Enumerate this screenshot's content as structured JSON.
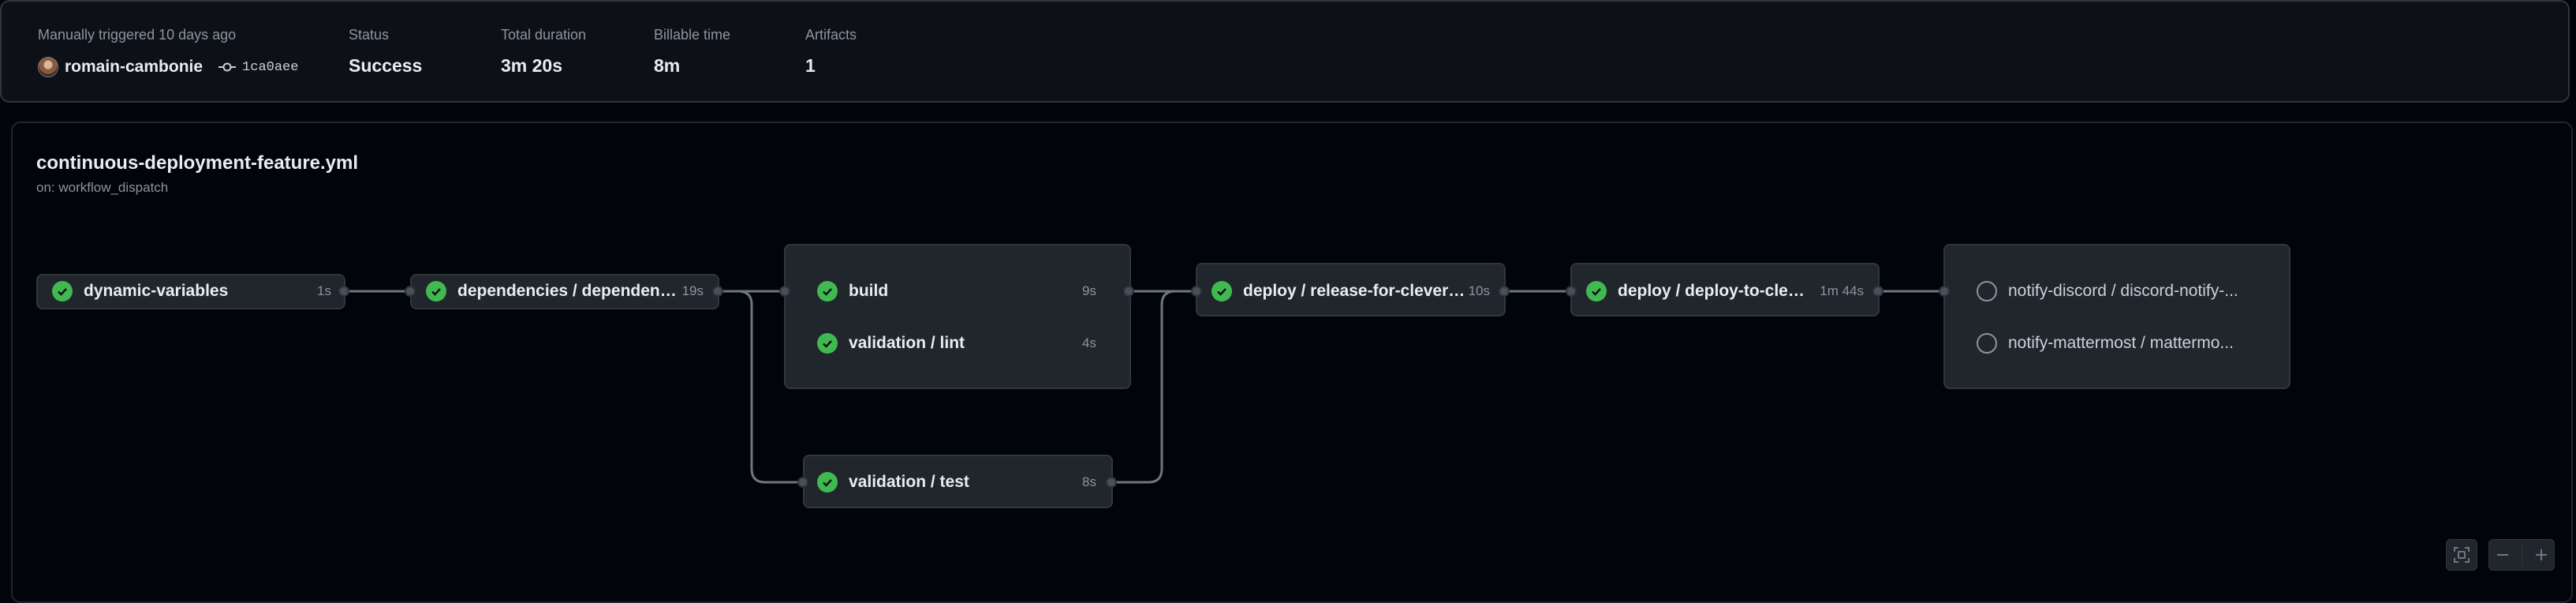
{
  "summary": {
    "trigger_text": "Manually triggered 10 days ago",
    "actor": "romain-cambonie",
    "commit_sha": "1ca0aee",
    "status_label": "Status",
    "status_value": "Success",
    "duration_label": "Total duration",
    "duration_value": "3m 20s",
    "billable_label": "Billable time",
    "billable_value": "8m",
    "artifacts_label": "Artifacts",
    "artifacts_value": "1"
  },
  "workflow": {
    "file": "continuous-deployment-feature.yml",
    "trigger": "on: workflow_dispatch"
  },
  "jobs": [
    {
      "name": "dynamic-variables",
      "duration": "1s",
      "status": "success"
    },
    {
      "name": "dependencies / dependencies",
      "duration": "19s",
      "status": "success"
    },
    {
      "name": "build",
      "duration": "9s",
      "status": "success"
    },
    {
      "name": "validation / lint",
      "duration": "4s",
      "status": "success"
    },
    {
      "name": "validation / test",
      "duration": "8s",
      "status": "success"
    },
    {
      "name": "deploy / release-for-clevercloud",
      "duration": "10s",
      "status": "success"
    },
    {
      "name": "deploy / deploy-to-clevercloud",
      "duration": "1m 44s",
      "status": "success"
    },
    {
      "name": "notify-discord / discord-notify-...",
      "duration": "",
      "status": "skipped"
    },
    {
      "name": "notify-mattermost / mattermo...",
      "duration": "",
      "status": "skipped"
    }
  ],
  "colors": {
    "success": "#3fb950",
    "background": "#010409",
    "panel": "#0d1117",
    "job_bg": "#21262d"
  },
  "icons": {
    "success": "check-circle-icon",
    "skipped": "circle-icon",
    "commit": "git-commit-icon",
    "fullscreen": "fullscreen-icon",
    "zoom_out": "minus-icon",
    "zoom_in": "plus-icon"
  }
}
